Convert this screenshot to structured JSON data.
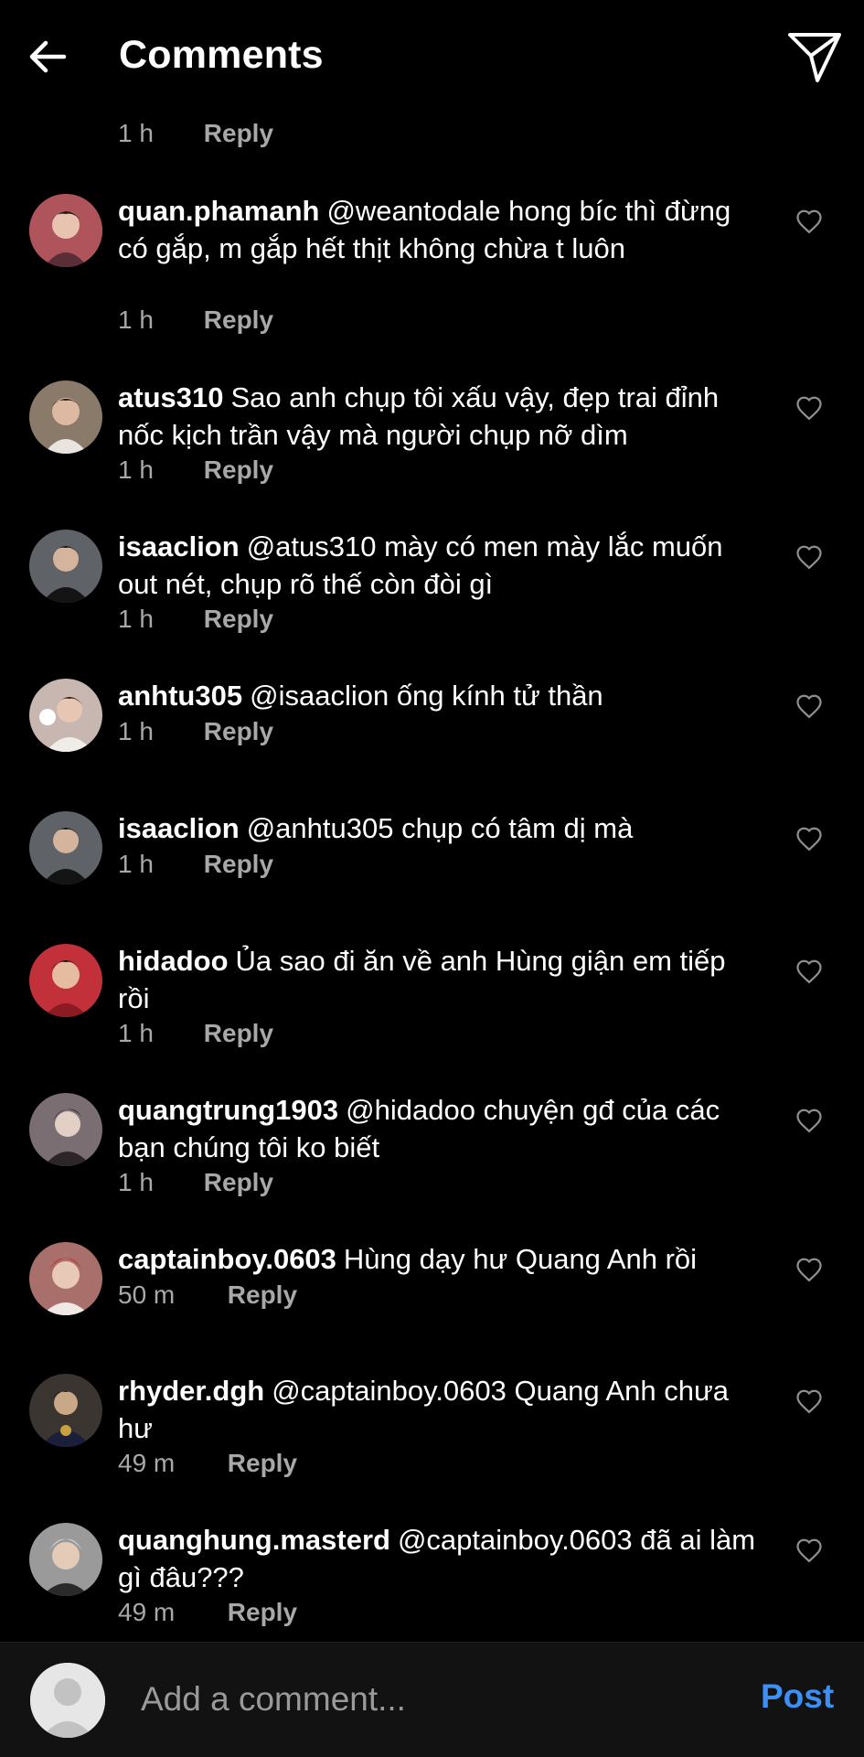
{
  "header": {
    "title": "Comments"
  },
  "partial": {
    "time": "1 h",
    "reply": "Reply"
  },
  "comments": [
    {
      "username": "quan.phamanh",
      "text": "@weantodale hong bíc thì đừng có gắp, m gắp hết thịt không chừa t luôn",
      "time": "1 h",
      "reply": "Reply",
      "avatar_color": "#b0545c"
    },
    {
      "username": "atus310",
      "text": "Sao anh chụp tôi xấu vậy, đẹp trai đỉnh nốc kịch trần vậy mà người chụp nỡ dìm",
      "time": "1 h",
      "reply": "Reply",
      "avatar_color": "#8a7a6a"
    },
    {
      "username": "isaaclion",
      "text": "@atus310 mày có men mày lắc muốn out nét, chụp rõ thế còn đòi gì",
      "time": "1 h",
      "reply": "Reply",
      "avatar_color": "#5f6266"
    },
    {
      "username": "anhtu305",
      "text": "@isaaclion ống kính tử thần",
      "time": "1 h",
      "reply": "Reply",
      "avatar_color": "#c8b6b0"
    },
    {
      "username": "isaaclion",
      "text": "@anhtu305 chụp có tâm dị mà",
      "time": "1 h",
      "reply": "Reply",
      "avatar_color": "#5f6266"
    },
    {
      "username": "hidadoo",
      "text": "Ủa sao đi ăn về anh Hùng giận em tiếp rồi",
      "time": "1 h",
      "reply": "Reply",
      "avatar_color": "#c2303a"
    },
    {
      "username": "quangtrung1903",
      "text": "@hidadoo chuyện gđ của các bạn chúng tôi ko biết",
      "time": "1 h",
      "reply": "Reply",
      "avatar_color": "#7a6e73"
    },
    {
      "username": "captainboy.0603",
      "text": "Hùng dạy hư Quang Anh rồi",
      "time": "50 m",
      "reply": "Reply",
      "avatar_color": "#a96f6a"
    },
    {
      "username": "rhyder.dgh",
      "text": "@captainboy.0603 Quang Anh chưa hư",
      "time": "49 m",
      "reply": "Reply",
      "avatar_color": "#3a3530"
    },
    {
      "username": "quanghung.masterd",
      "text": "@captainboy.0603 đã ai làm gì đâu???",
      "time": "49 m",
      "reply": "Reply",
      "avatar_color": "#9a9a9a"
    }
  ],
  "composer": {
    "placeholder": "Add a comment...",
    "post_label": "Post",
    "post_color": "#3d8ff5"
  },
  "icons": {
    "back": "arrow-left-icon",
    "send": "paper-plane-icon",
    "like": "heart-outline-icon",
    "profile": "user-silhouette-icon"
  }
}
